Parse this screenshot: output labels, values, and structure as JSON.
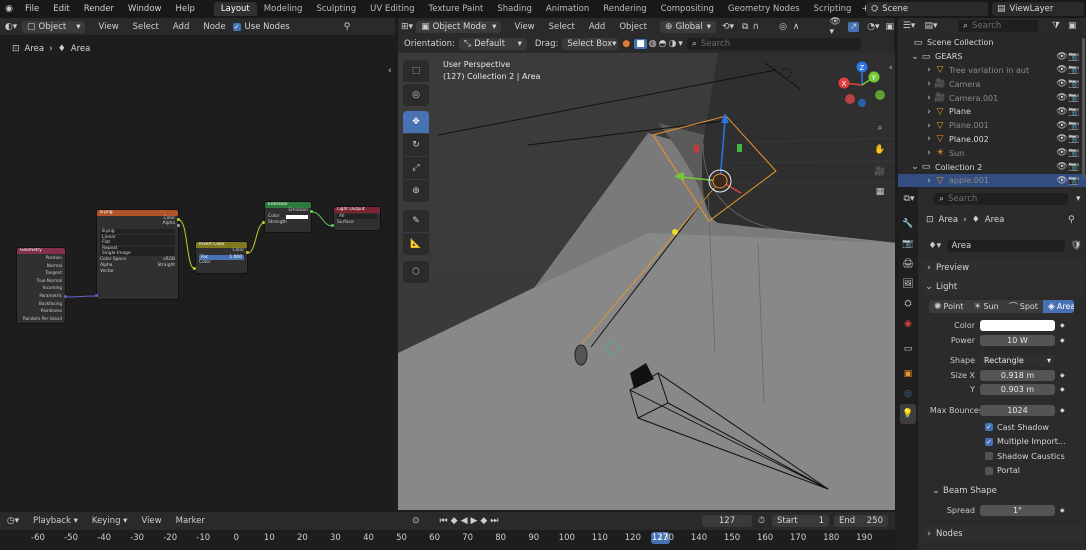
{
  "topbar": {
    "menus": [
      "File",
      "Edit",
      "Render",
      "Window",
      "Help"
    ],
    "workspaces": [
      "Layout",
      "Modeling",
      "Sculpting",
      "UV Editing",
      "Texture Paint",
      "Shading",
      "Animation",
      "Rendering",
      "Compositing",
      "Geometry Nodes",
      "Scripting"
    ],
    "active_workspace": "Layout",
    "scene": "Scene",
    "view_layer": "ViewLayer"
  },
  "node_editor": {
    "header": {
      "mode": "Object",
      "menus": [
        "View",
        "Select",
        "Add",
        "Node"
      ],
      "use_nodes": "Use Nodes"
    },
    "breadcrumb": [
      "Area",
      "Area"
    ],
    "nodes": {
      "geometry": {
        "title": "Geometry",
        "outputs": [
          "Position",
          "Normal",
          "Tangent",
          "True Normal",
          "Incoming",
          "Parametric",
          "Backfacing",
          "Pointiness",
          "Random Per Island"
        ]
      },
      "image": {
        "title": "8.png",
        "outputs": [
          "Color",
          "Alpha"
        ],
        "file": "8.png",
        "fields": [
          "Linear",
          "Flat",
          "Repeat",
          "Single Image"
        ],
        "color_space_label": "Color Space",
        "color_space": "sRGB",
        "alpha_label": "Alpha",
        "alpha": "Straight",
        "input": "Vector"
      },
      "invert": {
        "title": "Invert Color",
        "output": "Color",
        "fac_label": "Fac",
        "fac": "1.000",
        "input": "Color"
      },
      "emission": {
        "title": "Emission",
        "output": "Emission",
        "inputs": [
          "Color",
          "Strength"
        ]
      },
      "output": {
        "title": "Light Output",
        "target": "All",
        "input": "Surface"
      }
    }
  },
  "viewport": {
    "header": {
      "mode": "Object Mode",
      "menus": [
        "View",
        "Select",
        "Add",
        "Object"
      ],
      "transform": "Global"
    },
    "toolbar2": {
      "orientation_label": "Orientation:",
      "orientation": "Default",
      "drag_label": "Drag:",
      "drag": "Select Box",
      "search_placeholder": "Search"
    },
    "overlay": {
      "line1": "User Perspective",
      "line2_a": "(127) Collection 2",
      "line2_b": "Area"
    }
  },
  "outliner": {
    "search_placeholder": "Search",
    "items": [
      {
        "label": "Scene Collection",
        "color": "#d8d8d8"
      },
      {
        "label": "GEARS",
        "color": "#d8d8d8"
      },
      {
        "label": "Tree variation in aut",
        "color": "#8a8a8a"
      },
      {
        "label": "Camera",
        "color": "#8a8a8a"
      },
      {
        "label": "Camera.001",
        "color": "#8a8a8a"
      },
      {
        "label": "Plane",
        "color": "#d8d8d8"
      },
      {
        "label": "Plane.001",
        "color": "#8a8a8a"
      },
      {
        "label": "Plane.002",
        "color": "#d8d8d8"
      },
      {
        "label": "Sun",
        "color": "#8a8a8a"
      },
      {
        "label": "Collection 2",
        "color": "#d8d8d8"
      },
      {
        "label": "apple.001",
        "color": "#8a8a8a"
      }
    ]
  },
  "properties": {
    "search_placeholder": "Search",
    "breadcrumb": [
      "Area",
      "Area"
    ],
    "datablock": "Area",
    "sections": {
      "preview": "Preview",
      "light": "Light",
      "beam_shape": "Beam Shape",
      "nodes": "Nodes"
    },
    "light_types": [
      "Point",
      "Sun",
      "Spot",
      "Area"
    ],
    "active_light_type": "Area",
    "color_label": "Color",
    "color": "#ffffff",
    "power_label": "Power",
    "power": "10 W",
    "shape_label": "Shape",
    "shape": "Rectangle",
    "size_x_label": "Size X",
    "size_x": "0.918 m",
    "size_y_label": "Y",
    "size_y": "0.903 m",
    "max_bounces_label": "Max Bounces",
    "max_bounces": "1024",
    "checks": [
      {
        "label": "Cast Shadow",
        "checked": true
      },
      {
        "label": "Multiple Import...",
        "checked": true
      },
      {
        "label": "Shadow Caustics",
        "checked": false
      },
      {
        "label": "Portal",
        "checked": false
      }
    ],
    "spread_label": "Spread",
    "spread": "1°"
  },
  "timeline": {
    "menus": [
      "Playback",
      "Keying",
      "View",
      "Marker"
    ],
    "current_frame": "127",
    "start_label": "Start",
    "start": "1",
    "end_label": "End",
    "end": "250",
    "ticks": [
      "-60",
      "-50",
      "-40",
      "-30",
      "-20",
      "-10",
      "0",
      "10",
      "20",
      "30",
      "40",
      "50",
      "60",
      "70",
      "80",
      "90",
      "100",
      "110",
      "120",
      "130",
      "140",
      "150",
      "160",
      "170",
      "180",
      "190"
    ]
  }
}
